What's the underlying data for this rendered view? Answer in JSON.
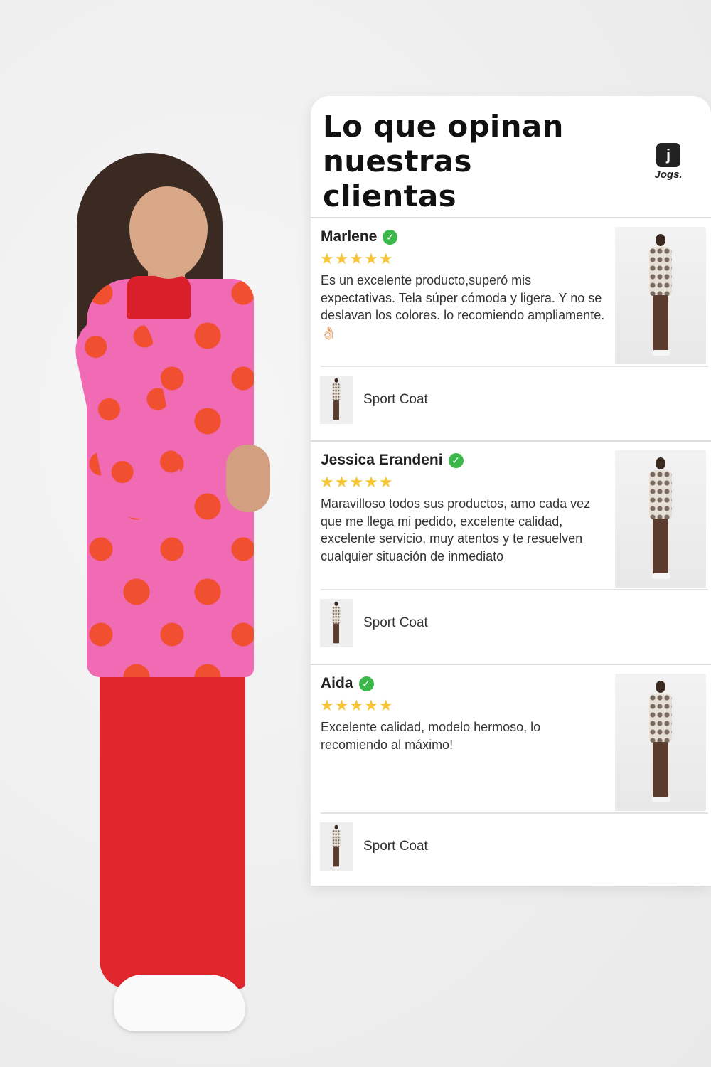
{
  "panel": {
    "title": "Lo que opinan nuestras clientas",
    "brand": {
      "logo_icon": "jogs-logo-icon",
      "name": "Jogs."
    }
  },
  "reviews": [
    {
      "name": "Marlene",
      "verified_icon": "check-circle-icon",
      "rating": 5,
      "stars": "★★★★★",
      "text": "Es un excelente producto,superó mis expectativas. Tela súper cómoda y ligera. Y no se deslavan los colores. lo recomiendo ampliamente. 👌🏻",
      "product": "Sport Coat"
    },
    {
      "name": "Jessica Erandeni",
      "verified_icon": "check-circle-icon",
      "rating": 5,
      "stars": "★★★★★",
      "text": "Maravilloso todos sus productos, amo cada vez que me llega mi pedido, excelente calidad, excelente servicio, muy atentos y te resuelven cualquier situación de inmediato",
      "product": "Sport Coat"
    },
    {
      "name": "Aida",
      "verified_icon": "check-circle-icon",
      "rating": 5,
      "stars": "★★★★★",
      "text": "Excelente calidad, modelo hermoso, lo recomiendo al máximo!",
      "product": "Sport Coat"
    }
  ],
  "colors": {
    "star": "#f5c533",
    "verified": "#3cb84a",
    "jacket_pink": "#f06ab4",
    "heart_red": "#f0502f",
    "pants_red": "#e1262e"
  }
}
